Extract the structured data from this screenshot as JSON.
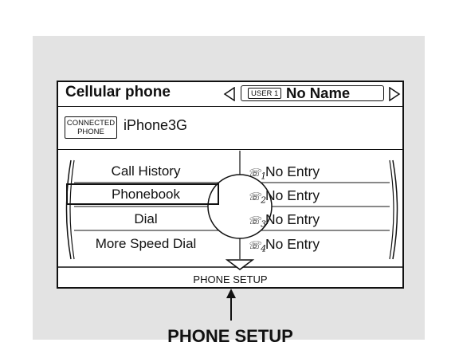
{
  "header": {
    "title": "Cellular phone",
    "user_badge": "USER 1",
    "user_name": "No Name"
  },
  "connection": {
    "badge_line1": "CONNECTED",
    "badge_line2": "PHONE",
    "device_name": "iPhone3G"
  },
  "menu": {
    "items": [
      {
        "label": "Call History"
      },
      {
        "label": "Phonebook",
        "selected": true
      },
      {
        "label": "Dial"
      },
      {
        "label": "More Speed Dial"
      }
    ]
  },
  "speed_dial": {
    "entries": [
      {
        "slot": "1",
        "label": "No Entry"
      },
      {
        "slot": "2",
        "label": "No Entry"
      },
      {
        "slot": "3",
        "label": "No Entry"
      },
      {
        "slot": "4",
        "label": "No Entry"
      }
    ]
  },
  "footer": {
    "setup_label": "PHONE SETUP"
  },
  "callout": {
    "label": "PHONE SETUP"
  }
}
